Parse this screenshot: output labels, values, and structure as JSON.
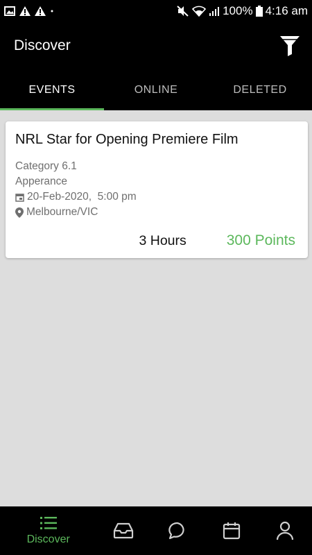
{
  "status_bar": {
    "battery": "100%",
    "time": "4:16 am"
  },
  "app_bar": {
    "title": "Discover"
  },
  "tabs": [
    {
      "label": "EVENTS",
      "active": true
    },
    {
      "label": "ONLINE",
      "active": false
    },
    {
      "label": "DELETED",
      "active": false
    }
  ],
  "event": {
    "title": "NRL Star for Opening Premiere Film",
    "category": "Category 6.1",
    "type": "Apperance",
    "datetime": "20-Feb-2020,  5:00 pm",
    "location": "Melbourne/VIC",
    "duration": "3 Hours",
    "points": "300 Points"
  },
  "bottom_nav": {
    "discover_label": "Discover",
    "items": [
      "list-icon",
      "inbox-icon",
      "chat-icon",
      "calendar-icon",
      "profile-icon"
    ]
  },
  "colors": {
    "accent": "#5cb85c",
    "bar_background": "#000000",
    "page_background": "#dddddd"
  }
}
